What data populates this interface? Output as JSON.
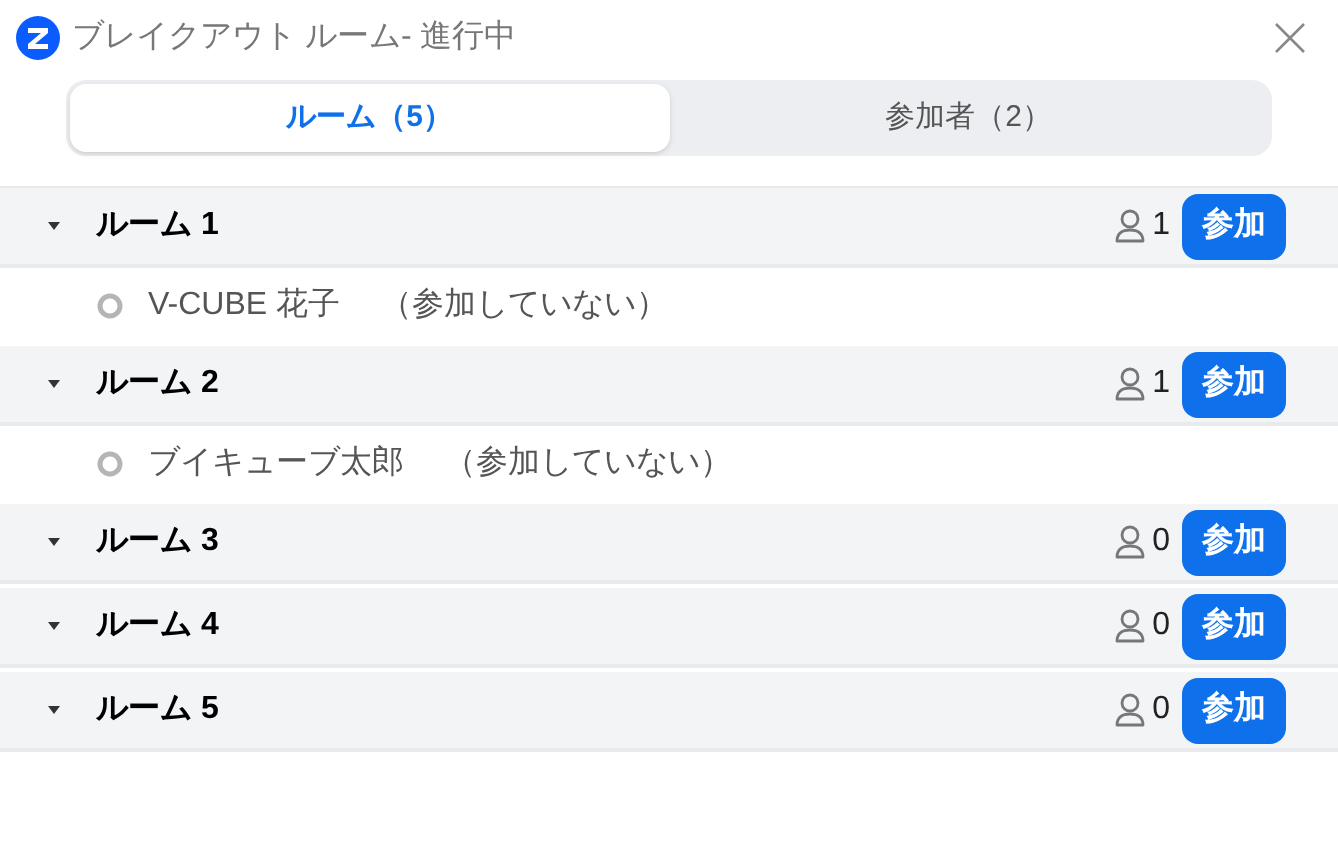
{
  "window": {
    "title": "ブレイクアウト ルーム- 進行中"
  },
  "tabs": [
    {
      "label": "ルーム（5）",
      "selected": true
    },
    {
      "label": "参加者（2）",
      "selected": false
    }
  ],
  "rooms": [
    {
      "name": "ルーム 1",
      "expanded": true,
      "count": "1",
      "button": "参加",
      "participants": [
        {
          "name": "V-CUBE 花子",
          "status": "（参加していない）"
        }
      ]
    },
    {
      "name": "ルーム 2",
      "expanded": true,
      "count": "1",
      "button": "参加",
      "participants": [
        {
          "name": "ブイキューブ太郎",
          "status": "（参加していない）"
        }
      ]
    },
    {
      "name": "ルーム 3",
      "expanded": true,
      "count": "0",
      "button": "参加"
    },
    {
      "name": "ルーム 4",
      "expanded": true,
      "count": "0",
      "button": "参加"
    },
    {
      "name": "ルーム 5",
      "expanded": true,
      "count": "0",
      "button": "参加"
    }
  ]
}
